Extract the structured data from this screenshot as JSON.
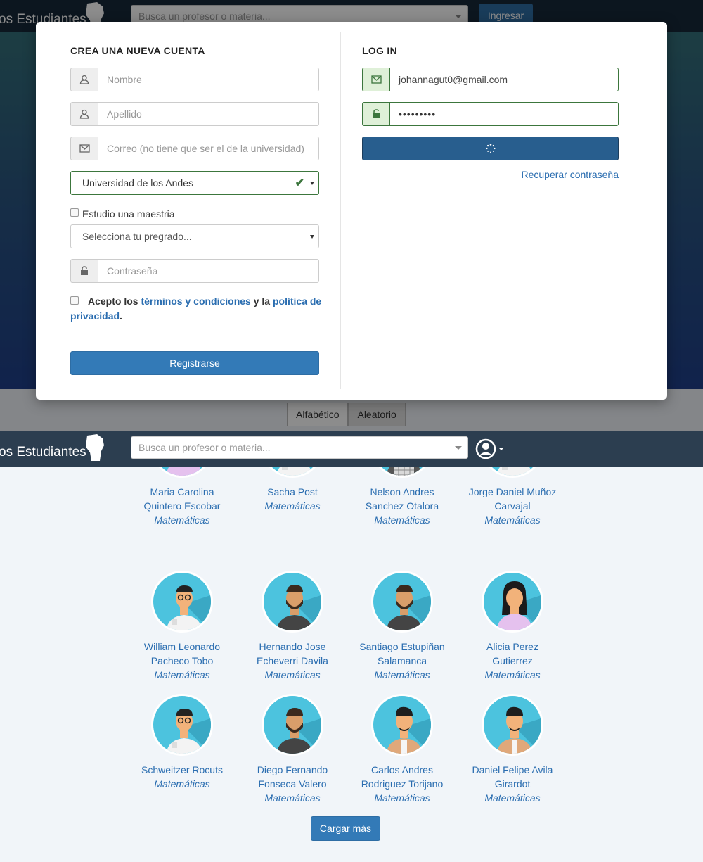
{
  "navbar": {
    "brand": "os Estudiantes",
    "search_placeholder": "Busca un profesor o materia...",
    "login_button": "Ingresar"
  },
  "sort": {
    "alphabetic": "Alfabético",
    "random": "Aleatorio"
  },
  "signup": {
    "title": "CREA UNA NUEVA CUENTA",
    "first_name_placeholder": "Nombre",
    "last_name_placeholder": "Apellido",
    "email_placeholder": "Correo (no tiene que ser el de la universidad)",
    "university_selected": "Universidad de los Andes",
    "masters_label": "Estudio una maestria",
    "program_placeholder": "Selecciona tu pregrado...",
    "password_placeholder": "Contraseña",
    "terms_prefix": "Acepto los",
    "terms_link": "términos y condiciones",
    "terms_mid": "y la",
    "privacy_link": "política de privacidad",
    "terms_suffix": ".",
    "register_button": "Registrarse"
  },
  "login": {
    "title": "LOG IN",
    "email_value": "johannagut0@gmail.com",
    "password_value": "•••••••••",
    "recover_link": "Recuperar contraseña"
  },
  "professors": [
    {
      "name": "Maria Carolina Quintero Escobar",
      "subject": "Matemáticas",
      "avatar": "woman-purple"
    },
    {
      "name": "Sacha Post",
      "subject": "Matemáticas",
      "avatar": "man-glasses-white"
    },
    {
      "name": "Nelson Andres Sanchez Otalora",
      "subject": "Matemáticas",
      "avatar": "man-blond-plaid"
    },
    {
      "name": "Jorge Daniel Muñoz Carvajal",
      "subject": "Matemáticas",
      "avatar": "man-glasses-white"
    },
    {
      "name": "William Leonardo Pacheco Tobo",
      "subject": "Matemáticas",
      "avatar": "man-glasses-white"
    },
    {
      "name": "Hernando Jose Echeverri Davila",
      "subject": "Matemáticas",
      "avatar": "man-beard-dark"
    },
    {
      "name": "Santiago Estupiñan Salamanca",
      "subject": "Matemáticas",
      "avatar": "man-beard-dark"
    },
    {
      "name": "Alicia Perez Gutierrez",
      "subject": "Matemáticas",
      "avatar": "woman-purple"
    },
    {
      "name": "Schweitzer Rocuts",
      "subject": "Matemáticas",
      "avatar": "man-glasses-white"
    },
    {
      "name": "Diego Fernando Fonseca Valero",
      "subject": "Matemáticas",
      "avatar": "man-beard-dark"
    },
    {
      "name": "Carlos Andres Rodriguez Torijano",
      "subject": "Matemáticas",
      "avatar": "man-tan-jacket"
    },
    {
      "name": "Daniel Felipe Avila Girardot",
      "subject": "Matemáticas",
      "avatar": "man-tan-jacket"
    }
  ],
  "load_more": "Cargar más",
  "colors": {
    "primary": "#337ab7",
    "navbar": "#2c3e50",
    "success": "#3c763d",
    "link": "#2a6db0",
    "avatar_bg": "#4cc3de"
  }
}
